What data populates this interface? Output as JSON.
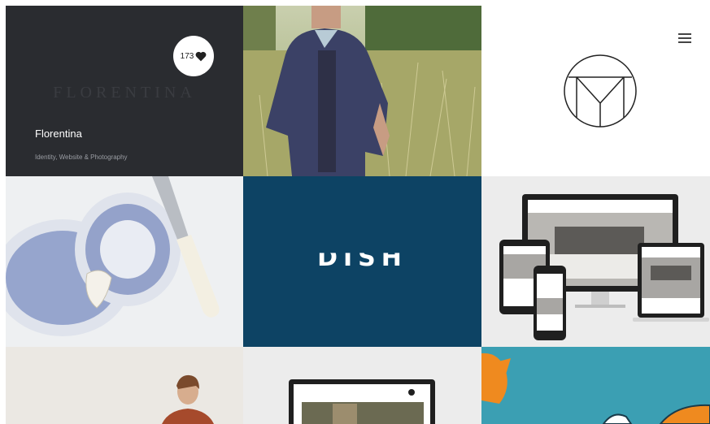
{
  "featured_project": {
    "title": "Florentina",
    "subtitle": "Identity, Website & Photography",
    "faint_logo_text": "FLORENTINA",
    "like_count": "173",
    "like_icon": "heart-icon"
  },
  "header": {
    "menu_icon": "hamburger-menu-icon"
  },
  "dish_tile": {
    "logo_text": "DISH"
  },
  "colors": {
    "dark_tile": "#2a2c30",
    "dish_blue": "#0d4364",
    "teal": "#3b9fb3",
    "orange": "#ef8a1f"
  }
}
